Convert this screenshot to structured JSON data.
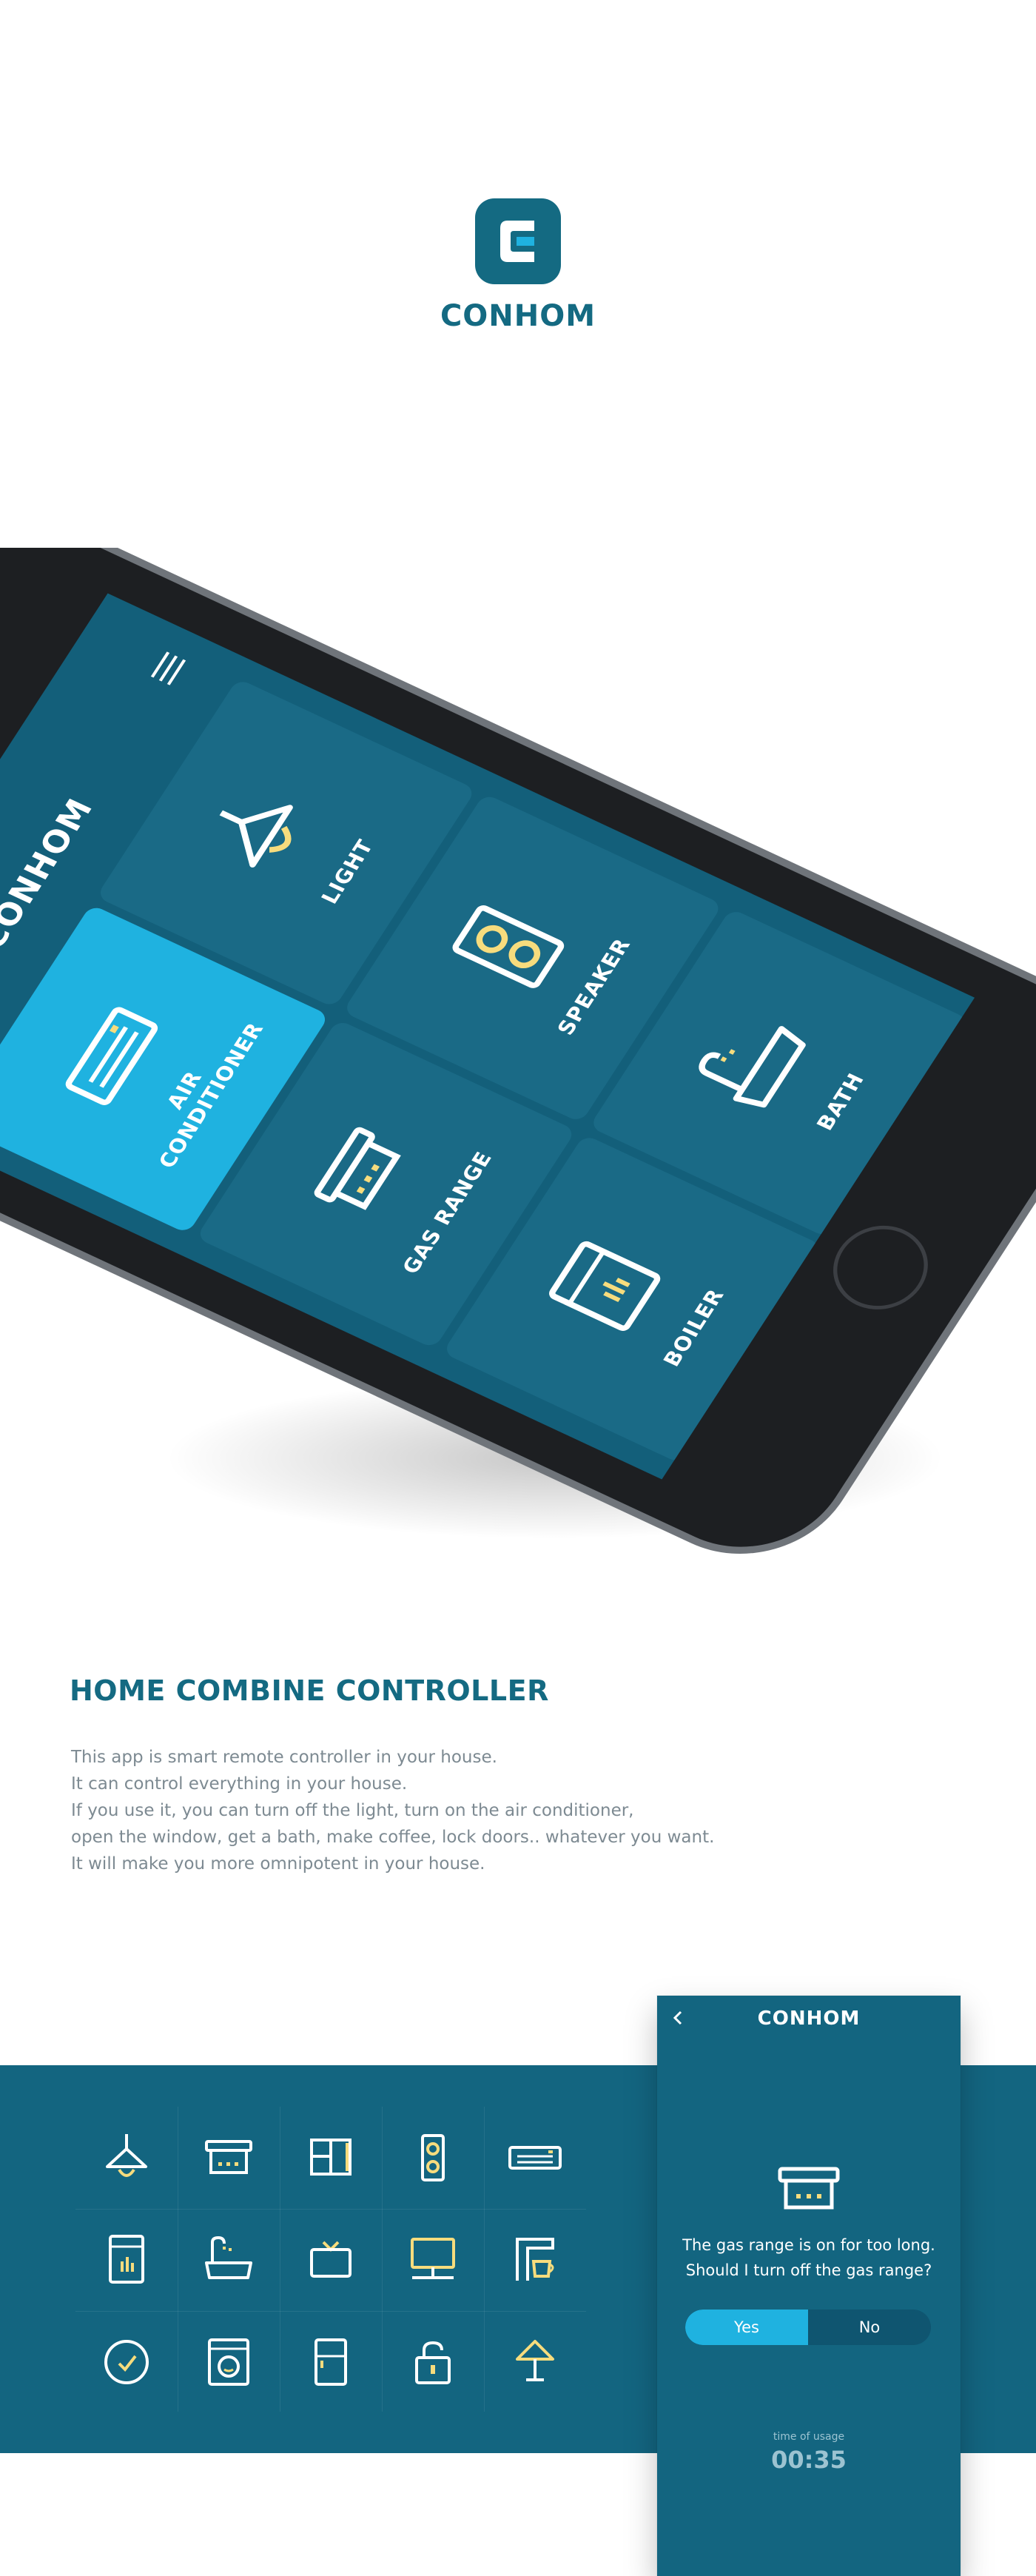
{
  "brand": {
    "name": "CONHOM"
  },
  "phone": {
    "title": "CONHOM",
    "tiles": [
      {
        "label": "AIR CONDITIONER",
        "icon": "air-conditioner-icon",
        "active": true
      },
      {
        "label": "LIGHT",
        "icon": "ceiling-lamp-icon",
        "active": false
      },
      {
        "label": "GAS RANGE",
        "icon": "gas-range-icon",
        "active": false
      },
      {
        "label": "SPEAKER",
        "icon": "speaker-icon",
        "active": false
      },
      {
        "label": "BOILER",
        "icon": "boiler-icon",
        "active": false
      },
      {
        "label": "BATH",
        "icon": "bath-icon",
        "active": false
      }
    ]
  },
  "section": {
    "title": "HOME COMBINE CONTROLLER",
    "lines": [
      "This app is smart remote controller in your house.",
      "It can control everything in your house.",
      "If you use it, you can turn off the light, turn on the air conditioner,",
      "open the window, get a bath, make coffee, lock doors.. whatever you want.",
      "It will make you more omnipotent in your house."
    ]
  },
  "icon_set": [
    "ceiling-lamp-icon",
    "gas-range-icon",
    "window-icon",
    "speaker-icon",
    "air-conditioner-icon",
    "boiler-icon",
    "bath-icon",
    "tv-icon",
    "computer-icon",
    "coffee-machine-icon",
    "clock-icon",
    "washing-machine-icon",
    "refrigerator-icon",
    "lock-icon",
    "table-lamp-icon"
  ],
  "dialog": {
    "title": "CONHOM",
    "message_line1": "The gas range is on for too long.",
    "message_line2": "Should I turn off the gas range?",
    "yes_label": "Yes",
    "no_label": "No",
    "usage_label": "time of usage",
    "usage_time": "00:35"
  },
  "colors": {
    "primary": "#146a82",
    "accent": "#1fb2e0",
    "highlight": "#f7dc7d",
    "text_gray": "#7d8a92"
  }
}
